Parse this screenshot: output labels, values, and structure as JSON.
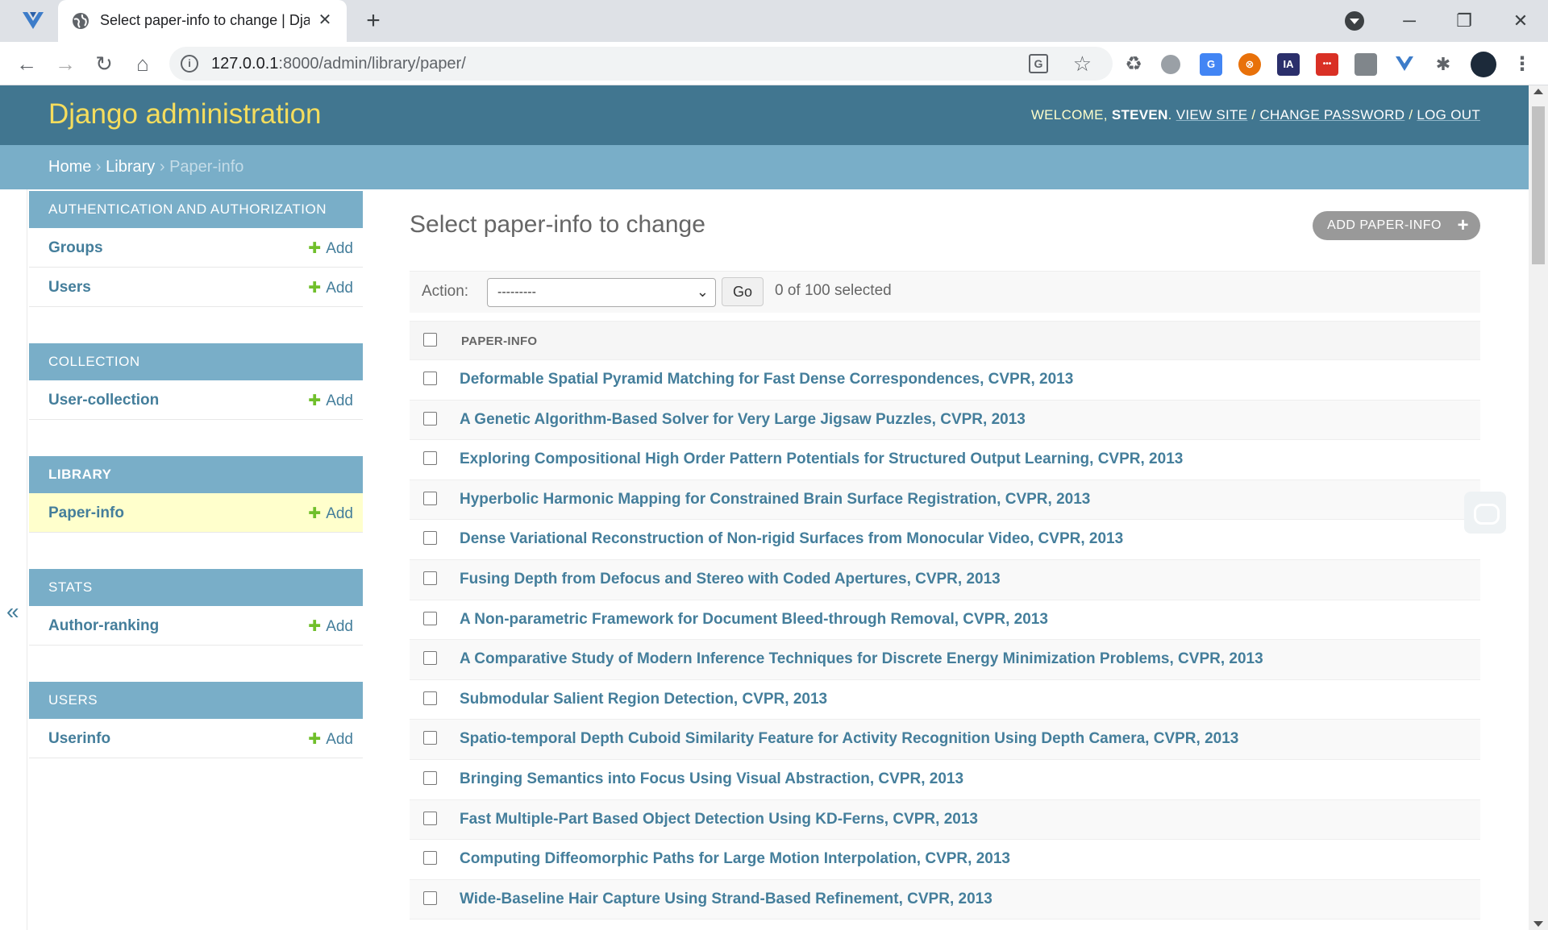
{
  "browser": {
    "tab_title": "Select paper-info to change | Dja",
    "url_host": "127.0.0.1",
    "url_rest": ":8000/admin/library/paper/",
    "new_tab": "+",
    "close": "✕",
    "minimize": "─",
    "restore": "❐",
    "win_close": "✕",
    "ext_ia": "IA",
    "ext_dots": "•••"
  },
  "header": {
    "branding": "Django administration",
    "welcome": "WELCOME,",
    "user": "STEVEN",
    "view_site": "VIEW SITE",
    "change_password": "CHANGE PASSWORD",
    "log_out": "LOG OUT"
  },
  "breadcrumbs": {
    "home": "Home",
    "library": "Library",
    "current": "Paper-info",
    "sep": "›"
  },
  "sidebar": {
    "toggle": "«",
    "add_label": "Add",
    "modules": [
      {
        "caption": "AUTHENTICATION AND AUTHORIZATION",
        "models": [
          "Groups",
          "Users"
        ]
      },
      {
        "caption": "COLLECTION",
        "models": [
          "User-collection"
        ]
      },
      {
        "caption": "LIBRARY",
        "models": [
          "Paper-info"
        ]
      },
      {
        "caption": "STATS",
        "models": [
          "Author-ranking"
        ]
      },
      {
        "caption": "USERS",
        "models": [
          "Userinfo"
        ]
      }
    ]
  },
  "content": {
    "title": "Select paper-info to change",
    "add_button": "ADD PAPER-INFO",
    "action_label": "Action:",
    "action_value": "---------",
    "go_label": "Go",
    "selected_text": "0 of 100 selected",
    "column_header": "PAPER-INFO",
    "rows": [
      "Deformable Spatial Pyramid Matching for Fast Dense Correspondences, CVPR, 2013",
      "A Genetic Algorithm-Based Solver for Very Large Jigsaw Puzzles, CVPR, 2013",
      "Exploring Compositional High Order Pattern Potentials for Structured Output Learning, CVPR, 2013",
      "Hyperbolic Harmonic Mapping for Constrained Brain Surface Registration, CVPR, 2013",
      "Dense Variational Reconstruction of Non-rigid Surfaces from Monocular Video, CVPR, 2013",
      "Fusing Depth from Defocus and Stereo with Coded Apertures, CVPR, 2013",
      "A Non-parametric Framework for Document Bleed-through Removal, CVPR, 2013",
      "A Comparative Study of Modern Inference Techniques for Discrete Energy Minimization Problems, CVPR, 2013",
      "Submodular Salient Region Detection, CVPR, 2013",
      "Spatio-temporal Depth Cuboid Similarity Feature for Activity Recognition Using Depth Camera, CVPR, 2013",
      "Bringing Semantics into Focus Using Visual Abstraction, CVPR, 2013",
      "Fast Multiple-Part Based Object Detection Using KD-Ferns, CVPR, 2013",
      "Computing Diffeomorphic Paths for Large Motion Interpolation, CVPR, 2013",
      "Wide-Baseline Hair Capture Using Strand-Based Refinement, CVPR, 2013"
    ]
  },
  "colors": {
    "header_bg": "#417690",
    "breadcrumb_bg": "#79aec8",
    "branding": "#f5dd5d",
    "link": "#447e9b",
    "add_plus": "#70bf2b",
    "current_row": "#ffffcc"
  }
}
